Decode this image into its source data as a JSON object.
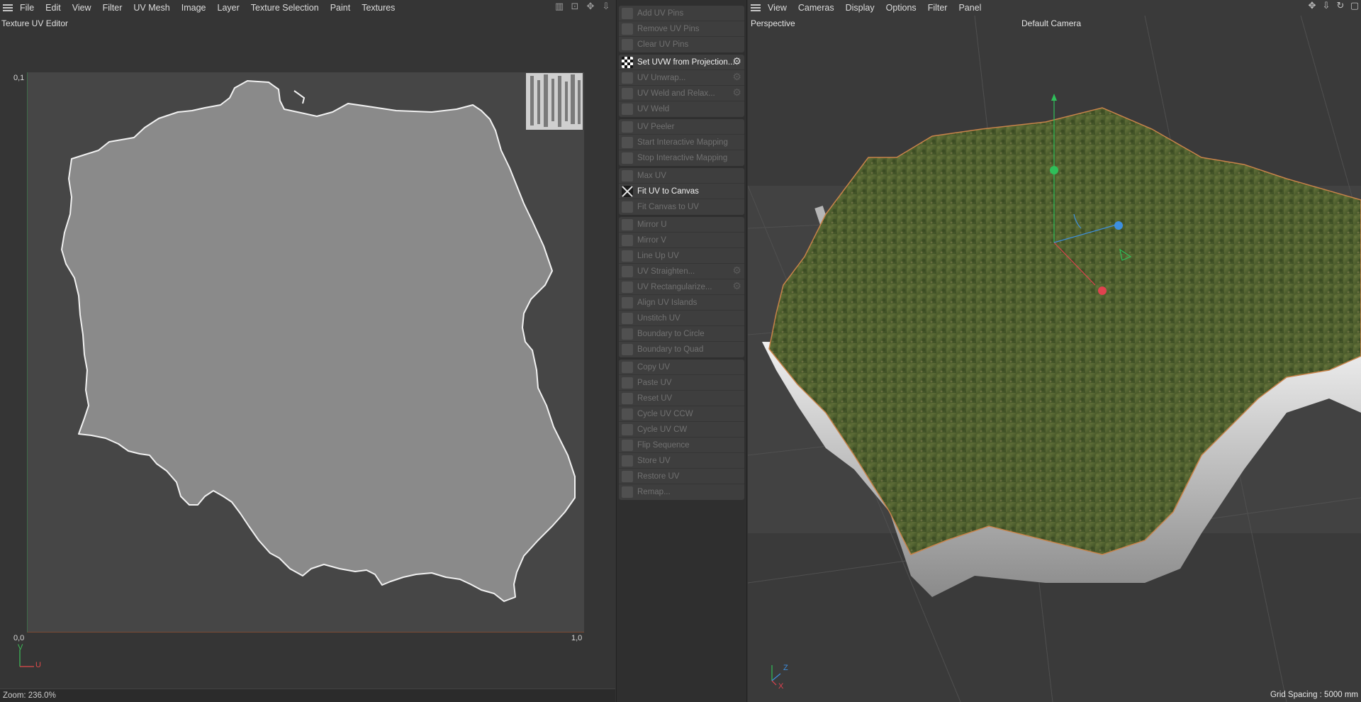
{
  "uv_editor": {
    "menu": [
      "File",
      "Edit",
      "View",
      "Filter",
      "UV Mesh",
      "Image",
      "Layer",
      "Texture Selection",
      "Paint",
      "Textures"
    ],
    "title": "Texture UV Editor",
    "axis_top_left": "0,1",
    "axis_bottom_left": "0,0",
    "axis_bottom_right": "1,0",
    "gizmo_v": "V",
    "gizmo_u": "U",
    "zoom": "Zoom: 236.0%",
    "toolbar_icons": [
      "histogram-icon",
      "lock-icon",
      "move-icon",
      "anchor-icon"
    ]
  },
  "commands": {
    "groups": [
      [
        {
          "label": "Add UV Pins",
          "active": false,
          "gear": false
        },
        {
          "label": "Remove UV Pins",
          "active": false,
          "gear": false
        },
        {
          "label": "Clear UV Pins",
          "active": false,
          "gear": false
        }
      ],
      [
        {
          "label": "Set UVW from Projection...",
          "active": true,
          "gear": true
        },
        {
          "label": "UV Unwrap...",
          "active": false,
          "gear": true
        },
        {
          "label": "UV Weld and Relax...",
          "active": false,
          "gear": true
        },
        {
          "label": "UV Weld",
          "active": false,
          "gear": false
        }
      ],
      [
        {
          "label": "UV Peeler",
          "active": false,
          "gear": false
        },
        {
          "label": "Start Interactive Mapping",
          "active": false,
          "gear": false
        },
        {
          "label": "Stop Interactive Mapping",
          "active": false,
          "gear": false
        }
      ],
      [
        {
          "label": "Max UV",
          "active": false,
          "gear": false
        },
        {
          "label": "Fit UV to Canvas",
          "active": true,
          "gear": false
        },
        {
          "label": "Fit Canvas to UV",
          "active": false,
          "gear": false
        }
      ],
      [
        {
          "label": "Mirror U",
          "active": false,
          "gear": false
        },
        {
          "label": "Mirror V",
          "active": false,
          "gear": false
        },
        {
          "label": "Line Up UV",
          "active": false,
          "gear": false
        },
        {
          "label": "UV Straighten...",
          "active": false,
          "gear": true
        },
        {
          "label": "UV Rectangularize...",
          "active": false,
          "gear": true
        },
        {
          "label": "Align UV Islands",
          "active": false,
          "gear": false
        },
        {
          "label": "Unstitch UV",
          "active": false,
          "gear": false
        },
        {
          "label": "Boundary to Circle",
          "active": false,
          "gear": false
        },
        {
          "label": "Boundary to Quad",
          "active": false,
          "gear": false
        }
      ],
      [
        {
          "label": "Copy UV",
          "active": false,
          "gear": false
        },
        {
          "label": "Paste UV",
          "active": false,
          "gear": false
        },
        {
          "label": "Reset UV",
          "active": false,
          "gear": false
        },
        {
          "label": "Cycle UV CCW",
          "active": false,
          "gear": false
        },
        {
          "label": "Cycle UV CW",
          "active": false,
          "gear": false
        },
        {
          "label": "Flip Sequence",
          "active": false,
          "gear": false
        },
        {
          "label": "Store UV",
          "active": false,
          "gear": false
        },
        {
          "label": "Restore UV",
          "active": false,
          "gear": false
        },
        {
          "label": "Remap...",
          "active": false,
          "gear": false
        }
      ]
    ]
  },
  "viewport": {
    "menu": [
      "View",
      "Cameras",
      "Display",
      "Options",
      "Filter",
      "Panel"
    ],
    "label": "Perspective",
    "camera": "Default Camera",
    "grid_spacing": "Grid Spacing : 5000 mm",
    "axis_z": "Z",
    "axis_x": "X",
    "toolbar_icons": [
      "move-view-icon",
      "pan-icon",
      "rotate-view-icon",
      "maximize-icon"
    ]
  },
  "colors": {
    "accent_green": "#2fbf5a",
    "accent_red": "#e0424f",
    "accent_blue": "#3d8fe0",
    "terrain_edge": "#c8834a"
  }
}
